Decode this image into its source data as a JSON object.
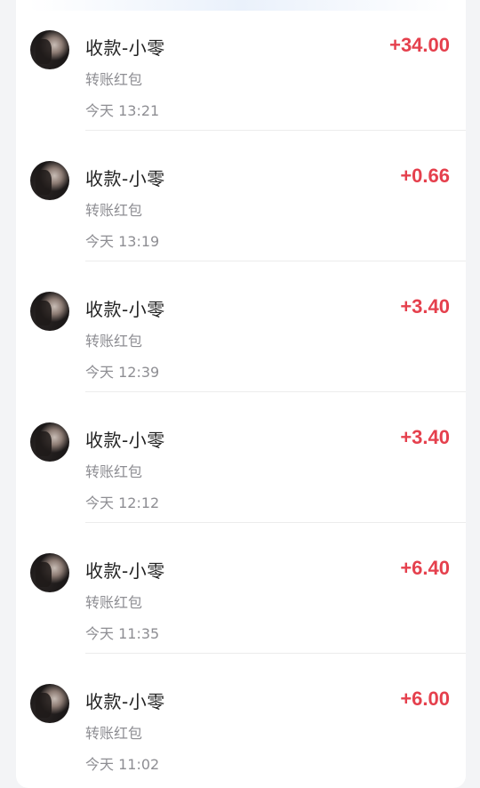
{
  "transactions": [
    {
      "title": "收款-小零",
      "type": "转账红包",
      "time": "今天 13:21",
      "amount": "+34.00"
    },
    {
      "title": "收款-小零",
      "type": "转账红包",
      "time": "今天 13:19",
      "amount": "+0.66"
    },
    {
      "title": "收款-小零",
      "type": "转账红包",
      "time": "今天 12:39",
      "amount": "+3.40"
    },
    {
      "title": "收款-小零",
      "type": "转账红包",
      "time": "今天 12:12",
      "amount": "+3.40"
    },
    {
      "title": "收款-小零",
      "type": "转账红包",
      "time": "今天 11:35",
      "amount": "+6.40"
    },
    {
      "title": "收款-小零",
      "type": "转账红包",
      "time": "今天 11:02",
      "amount": "+6.00"
    }
  ],
  "colors": {
    "amount": "#e5404d",
    "title": "#222222",
    "secondary": "#8e8e93",
    "background": "#f3f4f6"
  },
  "icons": {
    "avatar": "user-avatar-photo"
  }
}
